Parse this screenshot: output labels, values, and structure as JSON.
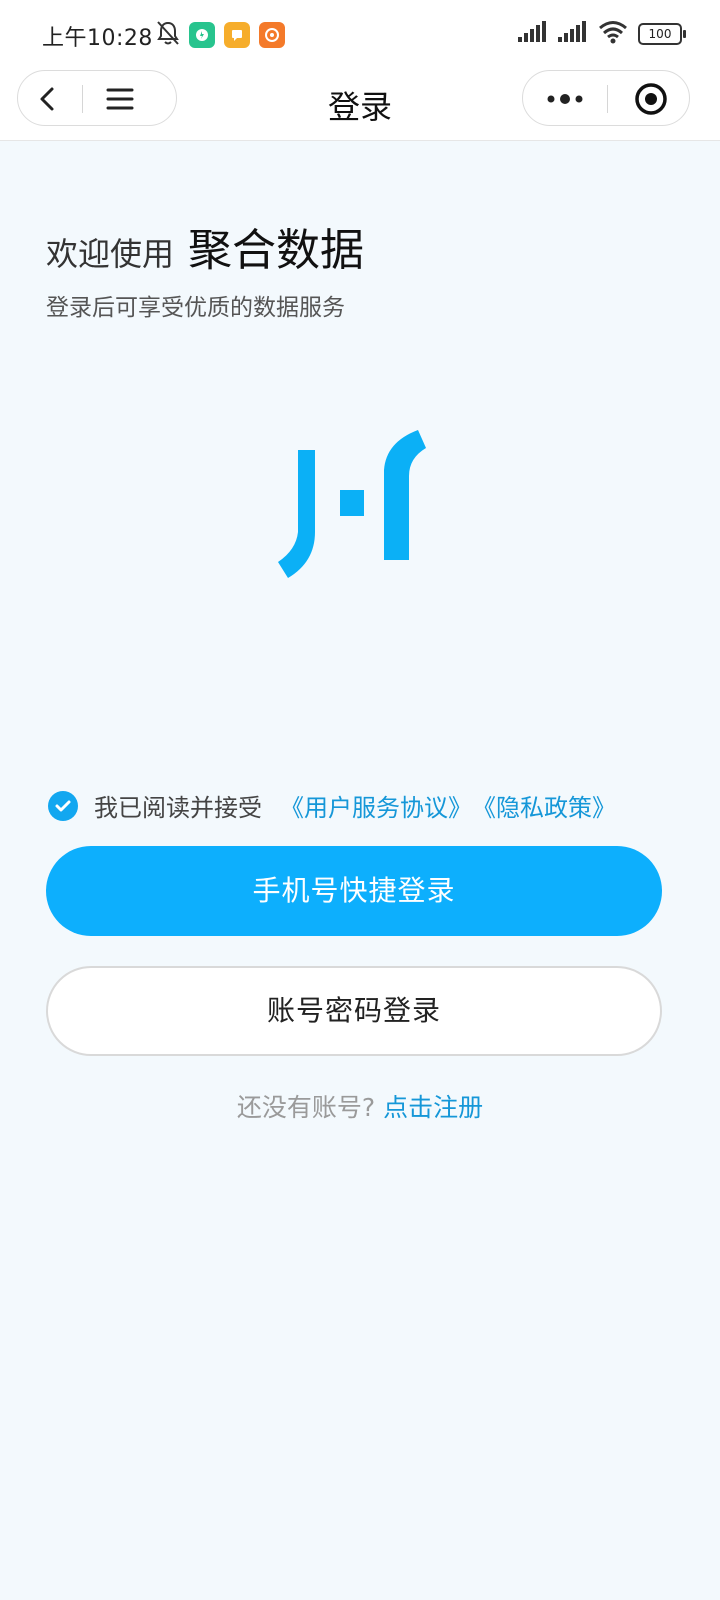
{
  "status_bar": {
    "time": "上午10:28",
    "battery": "100",
    "icons": [
      "bell-off-icon",
      "app-icon-green",
      "app-icon-yellow",
      "app-icon-orange",
      "signal-icon",
      "signal-icon",
      "wifi-icon",
      "battery-icon"
    ]
  },
  "nav": {
    "title": "登录"
  },
  "welcome": {
    "prefix": "欢迎使用",
    "app_name": "聚合数据",
    "subtitle": "登录后可享受优质的数据服务"
  },
  "agreement": {
    "text": "我已阅读并接受",
    "user_agreement": "《用户服务协议》",
    "privacy_policy": "《隐私政策》",
    "checked": true
  },
  "buttons": {
    "phone_login": "手机号快捷登录",
    "password_login": "账号密码登录"
  },
  "register": {
    "question": "还没有账号?",
    "link": "点击注册"
  },
  "colors": {
    "brand": "#0daffd",
    "link": "#1597d8",
    "background": "#f3f9fd"
  }
}
